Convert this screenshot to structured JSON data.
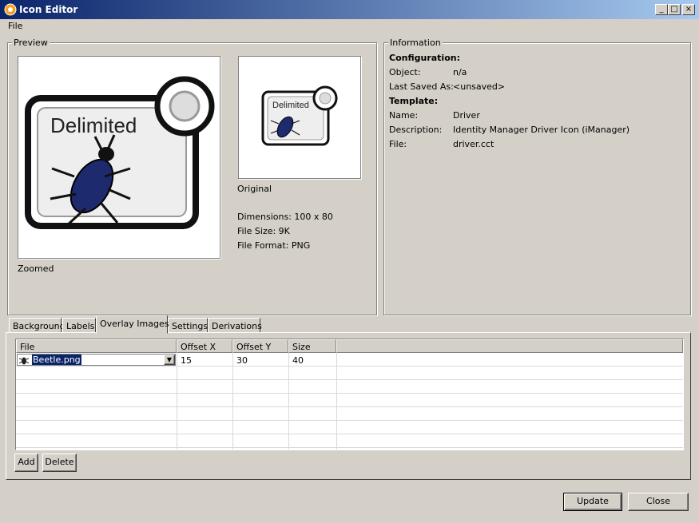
{
  "window": {
    "title": "Icon Editor"
  },
  "menu": {
    "file": "File"
  },
  "preview": {
    "legend": "Preview",
    "zoomed_label": "Zoomed",
    "original_label": "Original",
    "icon_text": "Delimited",
    "dimensions": "Dimensions: 100 x 80",
    "file_size": "File Size: 9K",
    "file_format": "File Format: PNG"
  },
  "information": {
    "legend": "Information",
    "configuration_heading": "Configuration:",
    "object_label": "Object:",
    "object_value": "n/a",
    "last_saved_label": "Last Saved As:",
    "last_saved_value": "<unsaved>",
    "template_heading": "Template:",
    "name_label": "Name:",
    "name_value": "Driver",
    "description_label": "Description:",
    "description_value": "Identity Manager Driver Icon (iManager)",
    "file_label": "File:",
    "file_value": "driver.cct"
  },
  "tabs": [
    "Background",
    "Labels",
    "Overlay Images",
    "Settings",
    "Derivations"
  ],
  "active_tab": "Overlay Images",
  "table": {
    "headers": [
      "File",
      "Offset X",
      "Offset Y",
      "Size"
    ],
    "rows": [
      {
        "file": "Beetle.png",
        "offset_x": "15",
        "offset_y": "30",
        "size": "40"
      }
    ]
  },
  "buttons": {
    "add": "Add",
    "delete": "Delete",
    "update": "Update",
    "close": "Close"
  },
  "colors": {
    "titlebar_start": "#0a246a",
    "titlebar_end": "#a6caf0",
    "face": "#d4d0c8",
    "selection": "#0a246a"
  }
}
